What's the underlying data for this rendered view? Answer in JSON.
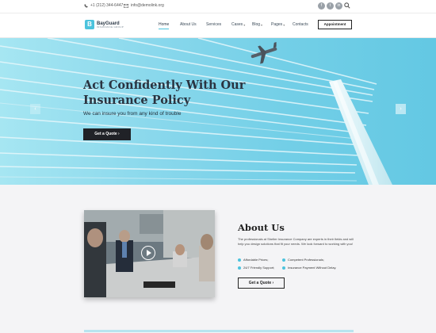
{
  "topbar": {
    "phone": "+1 (212) 344-6447",
    "email": "info@demolink.org",
    "social": [
      "f",
      "t",
      "in"
    ]
  },
  "logo": {
    "mark": "B",
    "name": "BayGuard",
    "sub": "INSURANCE GROUP"
  },
  "nav": {
    "items": [
      {
        "label": "Home",
        "active": true
      },
      {
        "label": "About Us"
      },
      {
        "label": "Services"
      },
      {
        "label": "Cases",
        "caret": true
      },
      {
        "label": "Blog",
        "caret": true
      },
      {
        "label": "Pages",
        "caret": true
      },
      {
        "label": "Contacts"
      }
    ],
    "cta": "Appointment",
    "caret": "▾"
  },
  "hero": {
    "title": "Act Confidently With Our\nInsurance Policy",
    "subtitle": "We can insure you from any kind of trouble",
    "button": "Get a Quote  ›",
    "prev": "‹",
    "next": "›"
  },
  "about": {
    "title": "About Us",
    "text": "The professionals at Shelter Insurance Company are experts in their fields and will help you design solutions that fit your needs. We look forward to working with you!",
    "features": [
      "Affordable Prices;",
      "Competent Professionals;",
      "24/7 Friendly Support;",
      "Insurance Payment Without Delay."
    ],
    "button": "Get a Quote  ›"
  },
  "colors": {
    "accent": "#4cc3dd",
    "dark": "#202227"
  }
}
